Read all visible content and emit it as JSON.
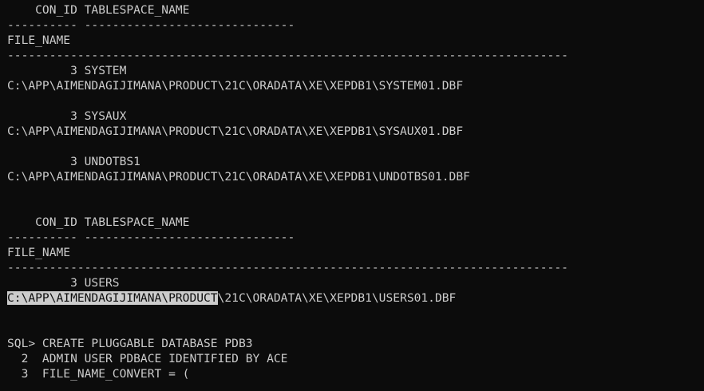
{
  "terminal": {
    "header1": "    CON_ID TABLESPACE_NAME",
    "sep1": "---------- ------------------------------",
    "header2": "FILE_NAME",
    "sep2": "--------------------------------------------------------------------------------",
    "row1_ts": "         3 SYSTEM",
    "row1_file": "C:\\APP\\AIMENDAGIJIMANA\\PRODUCT\\21C\\ORADATA\\XE\\XEPDB1\\SYSTEM01.DBF",
    "row2_ts": "         3 SYSAUX",
    "row2_file": "C:\\APP\\AIMENDAGIJIMANA\\PRODUCT\\21C\\ORADATA\\XE\\XEPDB1\\SYSAUX01.DBF",
    "row3_ts": "         3 UNDOTBS1",
    "row3_file": "C:\\APP\\AIMENDAGIJIMANA\\PRODUCT\\21C\\ORADATA\\XE\\XEPDB1\\UNDOTBS01.DBF",
    "header3": "    CON_ID TABLESPACE_NAME",
    "sep3": "---------- ------------------------------",
    "header4": "FILE_NAME",
    "sep4": "--------------------------------------------------------------------------------",
    "row4_ts": "         3 USERS",
    "row4_file_selected": "C:\\APP\\AIMENDAGIJIMANA\\PRODUCT",
    "row4_file_rest": "\\21C\\ORADATA\\XE\\XEPDB1\\USERS01.DBF",
    "sql1": "SQL> CREATE PLUGGABLE DATABASE PDB3",
    "sql2": "  2  ADMIN USER PDBACE IDENTIFIED BY ACE",
    "sql3": "  3  FILE_NAME_CONVERT = ("
  },
  "colors": {
    "background": "#0c0c0c",
    "foreground": "#cccccc",
    "selection": "#cccccc"
  }
}
